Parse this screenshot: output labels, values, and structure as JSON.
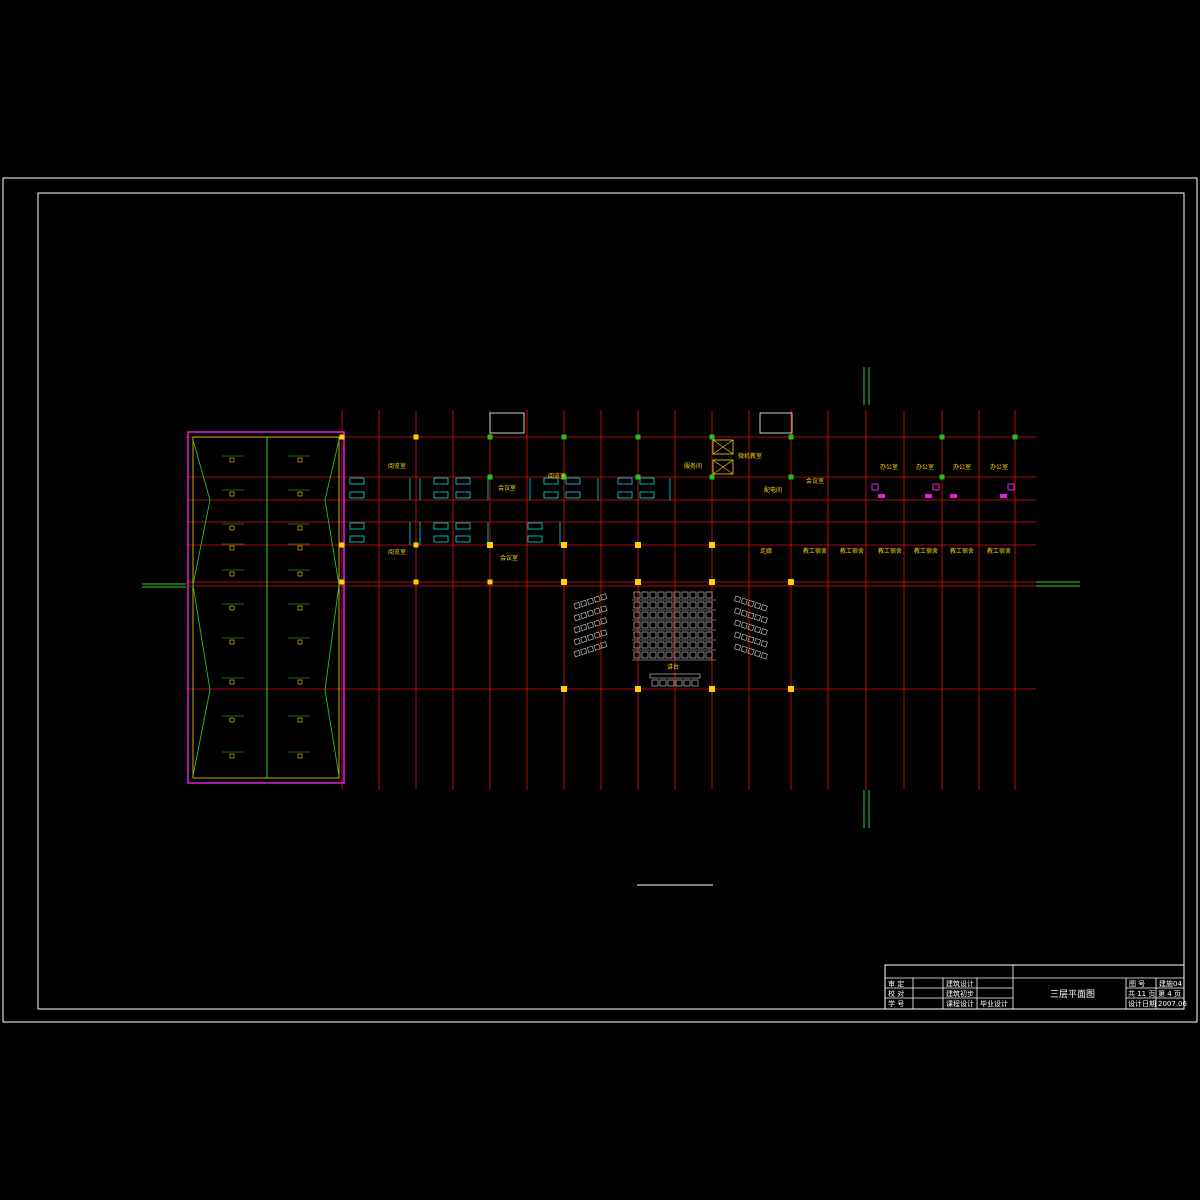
{
  "colors": {
    "background": "#000000",
    "grid": "#e01010",
    "column_yellow": "#ffd200",
    "column_green": "#20c020",
    "furniture": "#00e0e0",
    "seating": "#d8d8d8",
    "magenta": "#e020e0",
    "roof_green": "#30d030",
    "frame": "#ffffff"
  },
  "room_labels": [
    "阅览室",
    "会议室",
    "阅览室",
    "服务间",
    "微机教室",
    "配电间",
    "会议室",
    "办公室",
    "办公室",
    "办公室",
    "办公室",
    "阅览室",
    "会议室",
    "走廊",
    "教工宿舍",
    "教工宿舍",
    "教工宿舍",
    "教工宿舍",
    "教工宿舍",
    "教工宿舍",
    "讲台"
  ],
  "title_block": {
    "drawing_title": "三层平面图",
    "left_rows": [
      [
        "审 定",
        "",
        "建筑设计"
      ],
      [
        "校 对",
        "",
        "建筑初步"
      ],
      [
        "学 号",
        "",
        "课程设计",
        "毕业设计"
      ]
    ],
    "right_rows": [
      [
        "图 号",
        "建施04"
      ],
      [
        "共 11 页",
        "第 4 页"
      ],
      [
        "设计日期",
        "2007.06"
      ]
    ]
  }
}
